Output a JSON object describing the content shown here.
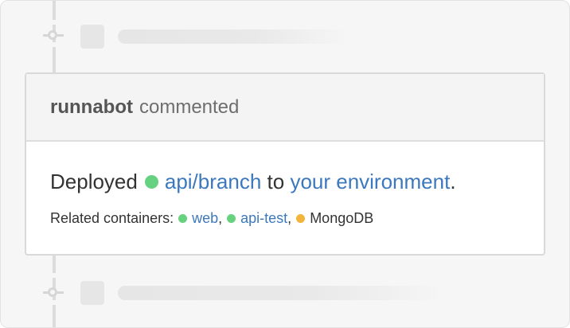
{
  "colors": {
    "running": "#66d17f",
    "pending": "#f2b43a",
    "link": "#3c78bd"
  },
  "comment": {
    "author": "runnabot",
    "action": "commented",
    "body": {
      "prefix": "Deployed",
      "branch": "api/branch",
      "branch_status": "running",
      "middle": "to",
      "environment_link": "your environment",
      "suffix": "."
    },
    "related": {
      "label": "Related containers:",
      "containers": [
        {
          "name": "web",
          "status": "running",
          "is_link": true
        },
        {
          "name": "api-test",
          "status": "running",
          "is_link": true
        },
        {
          "name": "MongoDB",
          "status": "pending",
          "is_link": false
        }
      ]
    }
  }
}
